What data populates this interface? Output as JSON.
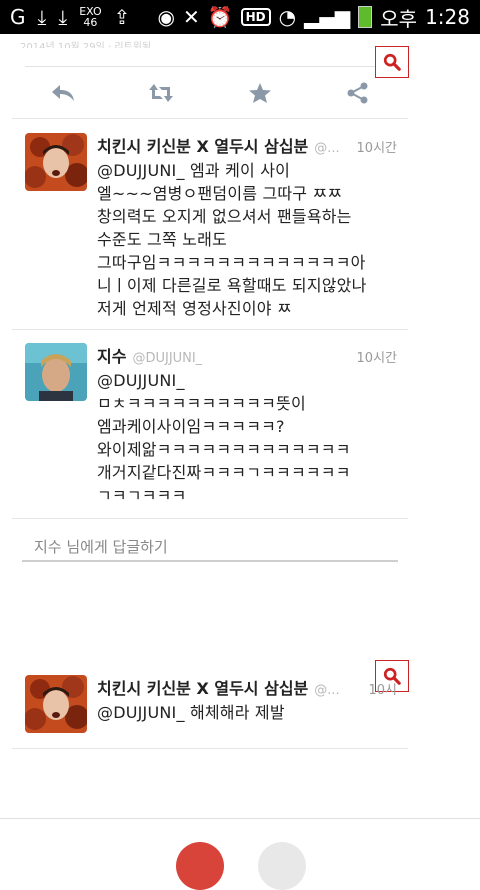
{
  "status_bar": {
    "exo_label": "EXO\n46",
    "hd_label": "HD",
    "carrier_label": "오후",
    "time": "1:28"
  },
  "top_faded_text": "2014년 10월 29일 · 리트윗됨",
  "actions": {
    "reply_icon": "reply-icon",
    "retweet_icon": "retweet-icon",
    "favorite_icon": "star-icon",
    "share_icon": "share-icon"
  },
  "tweets": [
    {
      "name": "치킨시 키신분 X 열두시 삼십분",
      "handle": "@...",
      "time": "10시간",
      "text": "@DUJJUNI_ 엠과 케이 사이\n엘~~~염병ㅇ팬덤이름 그따구 ㅉㅉ\n창의력도 오지게 없으셔서 팬들욕하는\n수준도 그쪽 노래도\n그따구임ㅋㅋㅋㅋㅋㅋㅋㅋㅋㅋㅋㅋㅋ아\n니ㅣ이제 다른길로 욕할때도 되지않았나\n저게 언제적 영정사진이야 ㅉ"
    },
    {
      "name": "지수",
      "handle": "@DUJJUNI_",
      "time": "10시간",
      "text": "@DUJJUNI_\nㅁㅊㅋㅋㅋㅋㅋㅋㅋㅋㅋㅋ뜻이\n엠과케이사이임ㅋㅋㅋㅋㅋ?\n와이제앎ㅋㅋㅋㅋㅋㅋㅋㅋㅋㅋㅋㅋㅋ\n개거지같다진짜ㅋㅋㅋㄱㅋㅋㅋㅋㅋㅋ\nㄱㅋㄱㅋㅋㅋ"
    },
    {
      "name": "치킨시 키신분 X 열두시 삼십분",
      "handle": "@...",
      "time": "10시",
      "text": "@DUJJUNI_ 해체해라 제발"
    }
  ],
  "reply_placeholder": "지수 님에게 답글하기"
}
